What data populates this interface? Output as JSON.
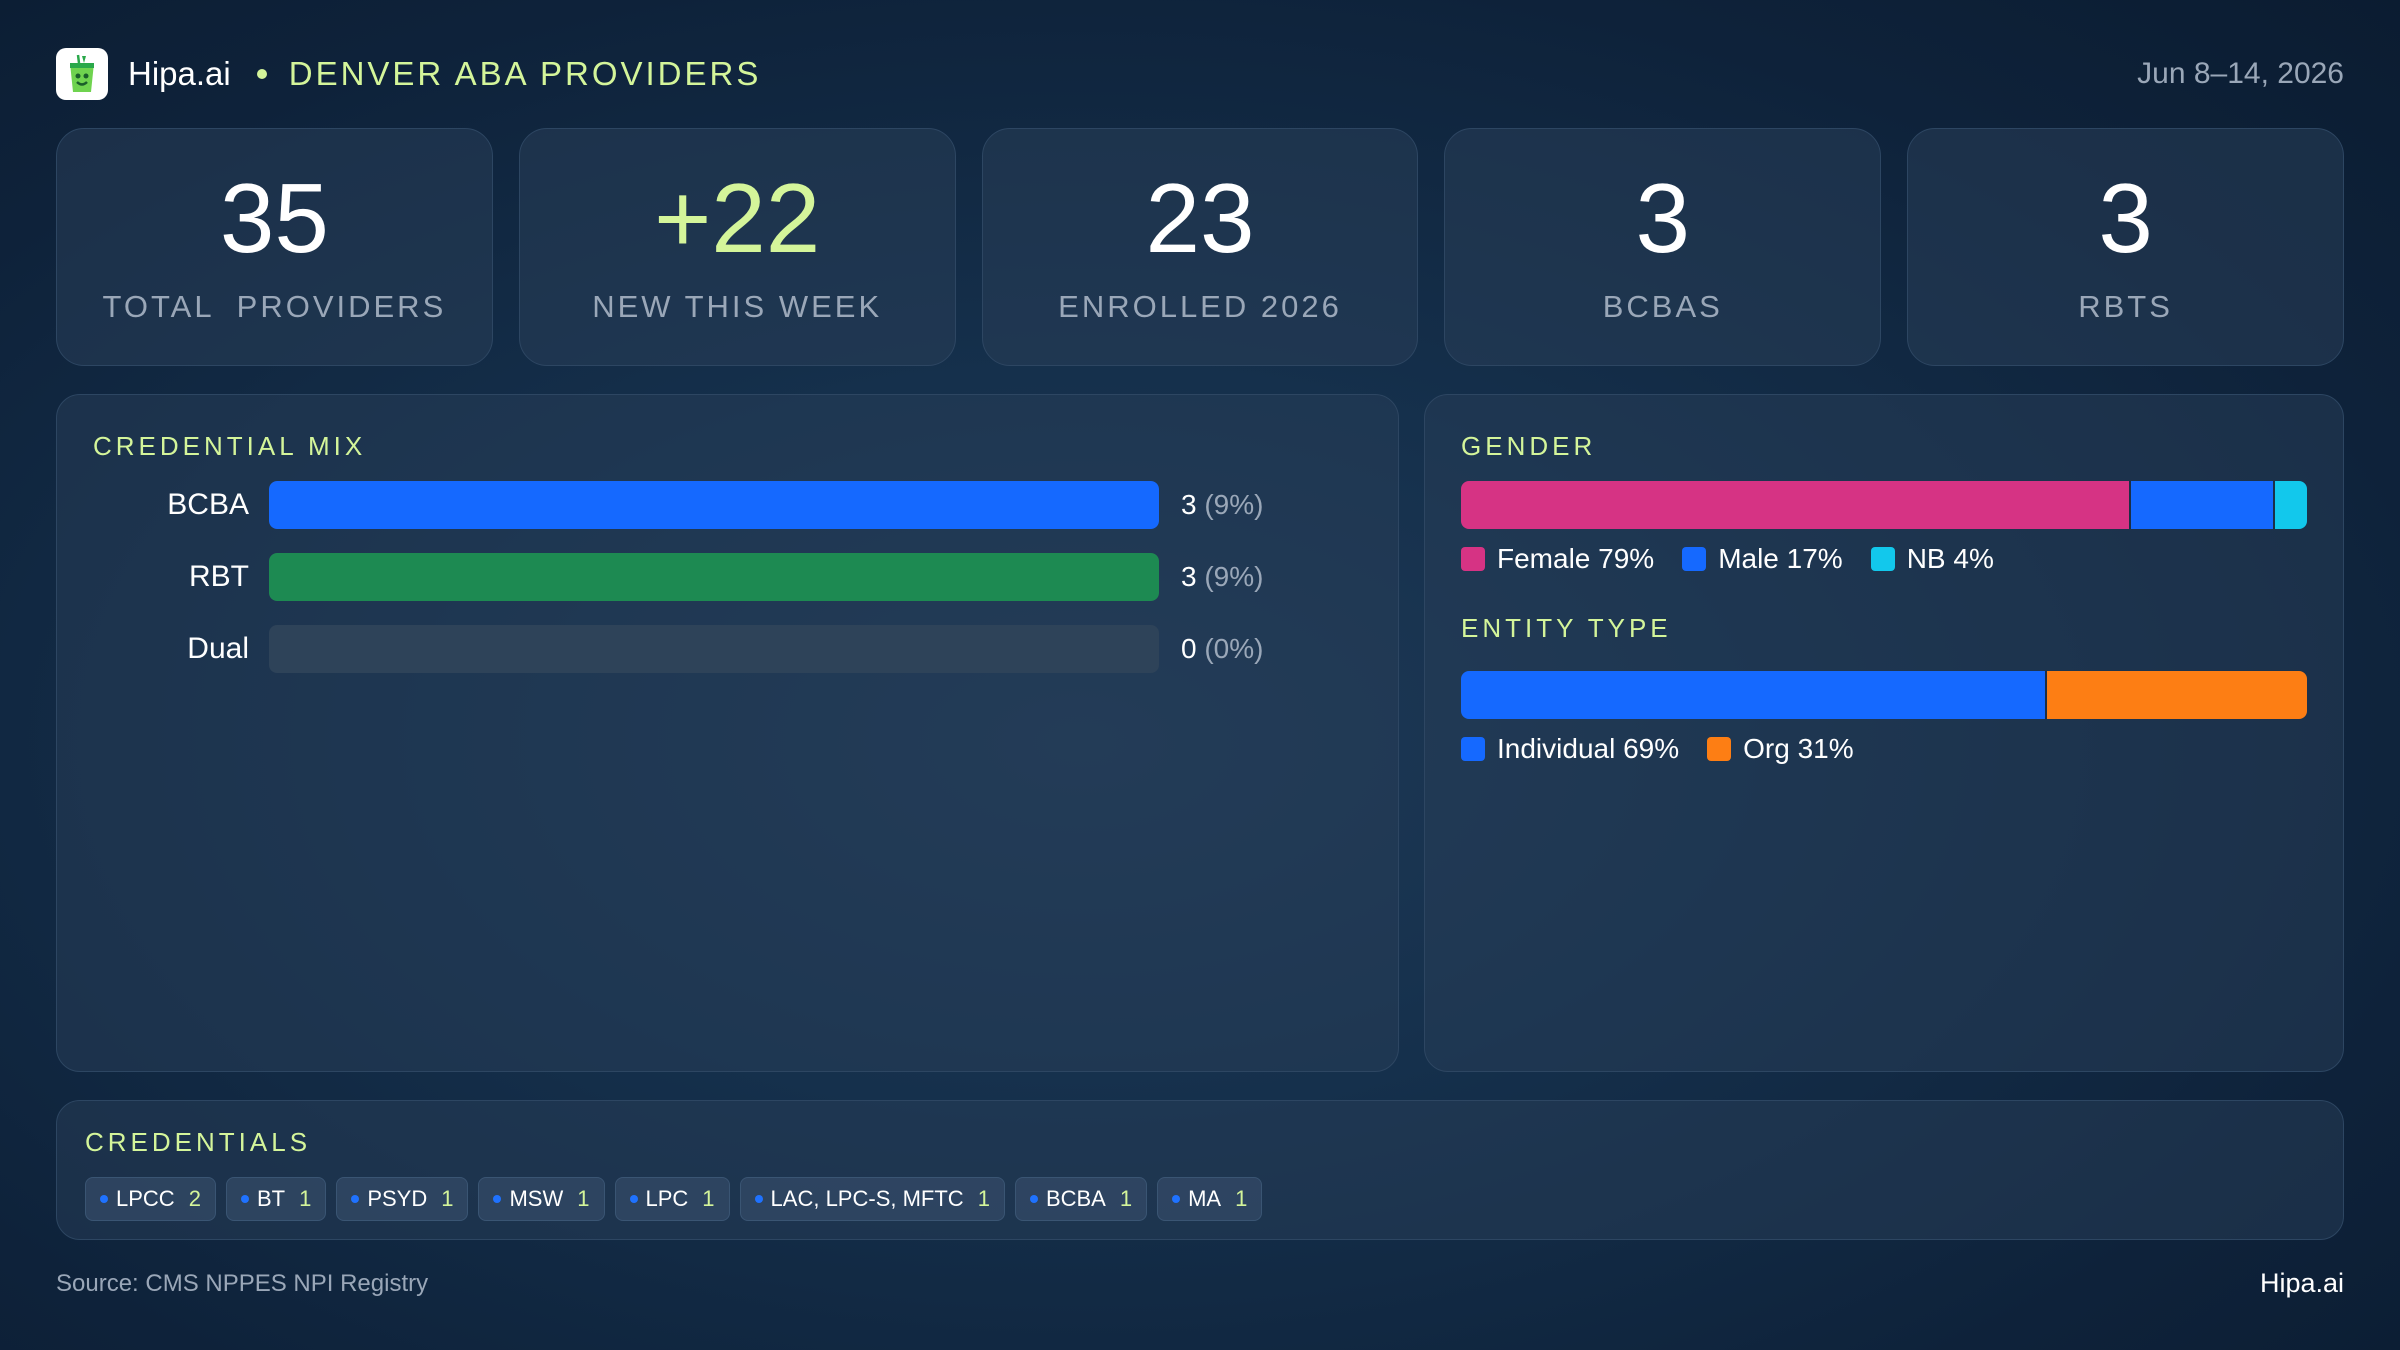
{
  "header": {
    "brand": "Hipa.ai",
    "title": "DENVER ABA PROVIDERS",
    "date": "Jun 8–14, 2026",
    "logo_icon": "drink-cup-icon"
  },
  "stats": [
    {
      "value": "35",
      "label": "TOTAL  PROVIDERS"
    },
    {
      "value": "+22",
      "label": "NEW THIS WEEK"
    },
    {
      "value": "23",
      "label": "ENROLLED 2026"
    },
    {
      "value": "3",
      "label": "BCBAS"
    },
    {
      "value": "3",
      "label": "RBTS"
    }
  ],
  "chart_data": [
    {
      "type": "bar",
      "title": "CREDENTIAL MIX",
      "categories": [
        "BCBA",
        "RBT",
        "Dual"
      ],
      "values": [
        3,
        3,
        0
      ],
      "value_labels": [
        "3",
        "3",
        "0"
      ],
      "percent_labels": [
        "(9%)",
        "(9%)",
        "(0%)"
      ],
      "colors": [
        "#1569ff",
        "#1d8a52",
        "#2e4359"
      ],
      "orientation": "horizontal",
      "xlim": [
        0,
        3
      ]
    },
    {
      "type": "bar",
      "title": "GENDER",
      "stacked": true,
      "series": [
        {
          "name": "Female",
          "value": 79,
          "label": "Female 79%",
          "color": "#d63384"
        },
        {
          "name": "Male",
          "value": 17,
          "label": "Male 17%",
          "color": "#1569ff"
        },
        {
          "name": "NB",
          "value": 4,
          "label": "NB 4%",
          "color": "#12c8ec"
        }
      ]
    },
    {
      "type": "bar",
      "title": "ENTITY TYPE",
      "stacked": true,
      "series": [
        {
          "name": "Individual",
          "value": 69,
          "label": "Individual 69%",
          "color": "#1569ff"
        },
        {
          "name": "Org",
          "value": 31,
          "label": "Org 31%",
          "color": "#fd7e14"
        }
      ]
    }
  ],
  "credentials": {
    "title": "CREDENTIALS",
    "chips": [
      {
        "name": "LPCC",
        "count": "2"
      },
      {
        "name": "BT",
        "count": "1"
      },
      {
        "name": "PSYD",
        "count": "1"
      },
      {
        "name": "MSW",
        "count": "1"
      },
      {
        "name": "LPC",
        "count": "1"
      },
      {
        "name": "LAC, LPC-S, MFTC",
        "count": "1"
      },
      {
        "name": "BCBA",
        "count": "1"
      },
      {
        "name": "MA",
        "count": "1"
      }
    ]
  },
  "footer": {
    "source": "Source: CMS NPPES NPI Registry",
    "brand": "Hipa.ai"
  }
}
